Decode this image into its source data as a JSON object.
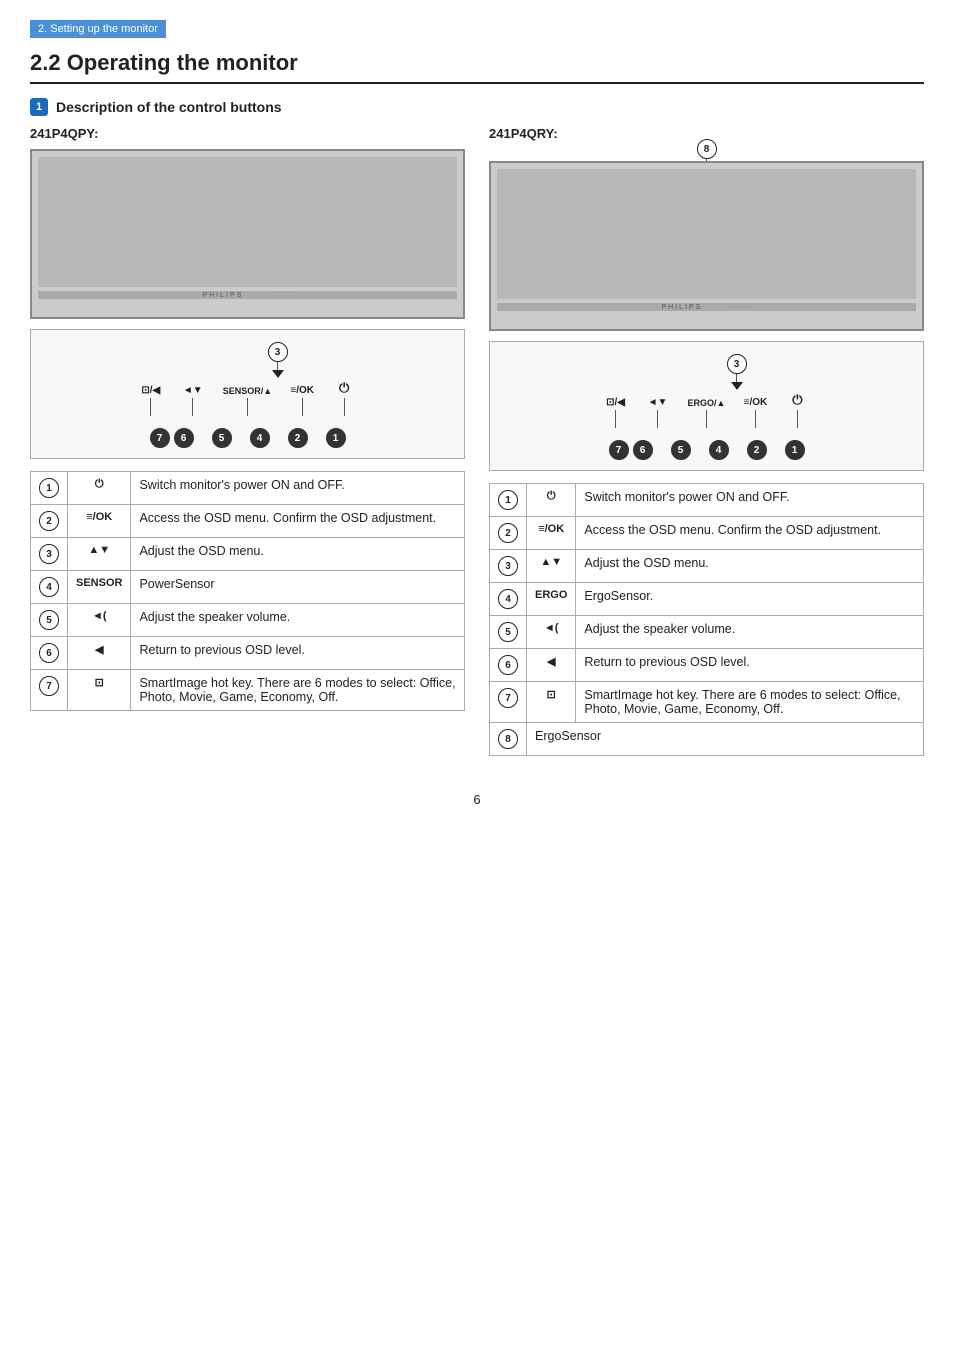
{
  "topbar": {
    "label": "2. Setting up the monitor"
  },
  "section": {
    "title": "2.2  Operating the monitor"
  },
  "subsection": {
    "badge": "1",
    "label": "Description of the control buttons"
  },
  "left_col": {
    "model": "241P4QPY:",
    "diagram_label": "241P4QPY button diagram"
  },
  "right_col": {
    "model": "241P4QRY:",
    "diagram_label": "241P4QRY button diagram"
  },
  "left_buttons": [
    {
      "icon": "⊡/◀",
      "label": ""
    },
    {
      "icon": "◄▼",
      "label": ""
    },
    {
      "icon": "SENSOR/▲",
      "label": ""
    },
    {
      "icon": "≡/OK",
      "label": ""
    },
    {
      "icon": "⏻",
      "label": ""
    }
  ],
  "left_nums": [
    "7",
    "6",
    "5",
    "4",
    "2",
    "1"
  ],
  "right_buttons": [
    {
      "icon": "⊡/◀",
      "label": ""
    },
    {
      "icon": "◄▼",
      "label": ""
    },
    {
      "icon": "ERGO/▲",
      "label": ""
    },
    {
      "icon": "≡/OK",
      "label": ""
    },
    {
      "icon": "⏻",
      "label": ""
    }
  ],
  "right_nums": [
    "7",
    "6",
    "5",
    "4",
    "2",
    "1"
  ],
  "left_table": [
    {
      "num": "1",
      "icon": "⏻",
      "text": "Switch monitor's power ON and OFF."
    },
    {
      "num": "2",
      "icon": "≡/OK",
      "text": "Access the OSD menu. Confirm the OSD adjustment."
    },
    {
      "num": "3",
      "icon": "▲▼",
      "text": "Adjust the OSD menu."
    },
    {
      "num": "4",
      "icon": "SENSOR",
      "text": "PowerSensor"
    },
    {
      "num": "5",
      "icon": "◄(",
      "text": "Adjust the speaker volume."
    },
    {
      "num": "6",
      "icon": "◀",
      "text": "Return to previous OSD level."
    },
    {
      "num": "7",
      "icon": "⊡",
      "text": "SmartImage hot key. There are 6 modes to select: Office, Photo, Movie, Game, Economy, Off."
    }
  ],
  "right_table": [
    {
      "num": "1",
      "icon": "⏻",
      "text": "Switch monitor's power ON and OFF."
    },
    {
      "num": "2",
      "icon": "≡/OK",
      "text": "Access the OSD menu. Confirm the OSD adjustment."
    },
    {
      "num": "3",
      "icon": "▲▼",
      "text": "Adjust the OSD menu."
    },
    {
      "num": "4",
      "icon": "ERGO",
      "text": "ErgoSensor."
    },
    {
      "num": "5",
      "icon": "◄(",
      "text": "Adjust the speaker volume."
    },
    {
      "num": "6",
      "icon": "◀",
      "text": "Return to previous OSD level."
    },
    {
      "num": "7",
      "icon": "⊡",
      "text": "SmartImage hot key. There are 6 modes to select: Office, Photo, Movie, Game, Economy, Off."
    },
    {
      "num": "8",
      "icon": "",
      "text": "ErgoSensor"
    }
  ],
  "page_number": "6"
}
